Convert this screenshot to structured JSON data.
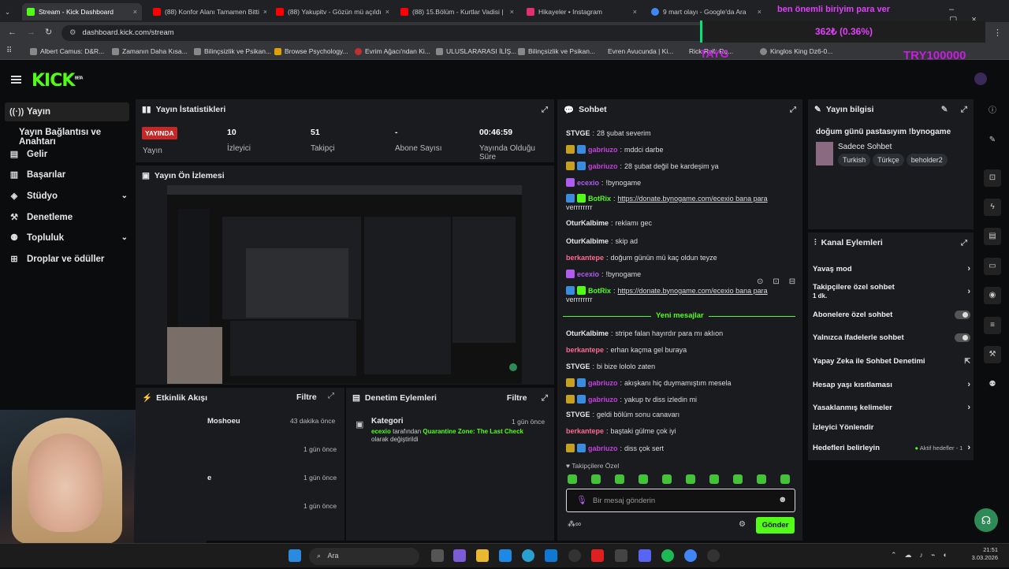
{
  "browser": {
    "tabs": [
      {
        "label": "Stream - Kick Dashboard",
        "color": "#53fc18"
      },
      {
        "label": "(88) Konfor Alanı Tamamen Bitti",
        "color": "#ff0000"
      },
      {
        "label": "(88) Yakupitv - Gözün mü açıldı",
        "color": "#ff0000"
      },
      {
        "label": "(88) 15.Bölüm - Kurtlar Vadisi |",
        "color": "#ff0000"
      },
      {
        "label": "Hikayeler • Instagram",
        "color": "#e1306c"
      },
      {
        "label": "9 mart olayı - Google'da Ara",
        "color": "#4285f4"
      }
    ],
    "url": "dashboard.kick.com/stream",
    "bookmarks": [
      "Albert Camus: D&R...",
      "Zamanın Daha Kısa...",
      "Bilinçsizlik ve Psikan...",
      "Browse Psychology...",
      "Evrim Ağacı'ndan Ki...",
      "ULUSLARARASI İLİŞ...",
      "Bilinçsizlik ve Psikan...",
      "Evren Avucunda | Ki...",
      "Rick Roll: Ro...",
      "Kinglos King Dz6-0..."
    ]
  },
  "overlay": {
    "banner": "ben önemli biriyim para ver",
    "goal": "362₺ (0.36%)",
    "left_tag": "TAYG",
    "right_tag": "TRY100000"
  },
  "kick": {
    "logo": "KICK",
    "beta": "BETA"
  },
  "sidebar": {
    "items": [
      {
        "label": "Yayın",
        "icon": "signal-icon"
      },
      {
        "label": "Yayın Bağlantısı ve Anahtarı",
        "icon": ""
      },
      {
        "label": "Gelir",
        "icon": "wallet-icon"
      },
      {
        "label": "Başarılar",
        "icon": "trophy-icon"
      },
      {
        "label": "Stüdyo",
        "icon": "studio-icon"
      },
      {
        "label": "Denetleme",
        "icon": "hammer-icon"
      },
      {
        "label": "Topluluk",
        "icon": "community-icon"
      },
      {
        "label": "Droplar ve ödüller",
        "icon": "gift-icon"
      }
    ]
  },
  "stats": {
    "title": "Yayın İstatistikleri",
    "live_badge": "YAYINDA",
    "live_label": "Yayın",
    "viewers": {
      "value": "10",
      "label": "İzleyici"
    },
    "followers": {
      "value": "51",
      "label": "Takipçi"
    },
    "subs": {
      "value": "-",
      "label": "Abone Sayısı"
    },
    "uptime": {
      "value": "00:46:59",
      "label": "Yayında Olduğu Süre"
    }
  },
  "preview": {
    "title": "Yayın Ön İzlemesi"
  },
  "activity": {
    "title": "Etkinlik Akışı",
    "filter": "Filtre",
    "items": [
      {
        "name": "Moshoeu",
        "time": "43 dakika önce"
      },
      {
        "name": "",
        "time": "1 gün önce"
      },
      {
        "name": "e",
        "time": "1 gün önce"
      },
      {
        "name": "",
        "time": "1 gün önce"
      }
    ]
  },
  "moderation": {
    "title": "Denetim Eylemleri",
    "filter": "Filtre",
    "item_title": "Kategori",
    "item_time": "1 gün önce",
    "item_user": "ecexio",
    "item_mid": " tarafından ",
    "item_game": "Quarantine Zone: The Last Check",
    "item_end": "olarak değiştirildi"
  },
  "chat": {
    "title": "Sohbet",
    "messages": [
      {
        "user": "STVGE",
        "color": "#e8e8e8",
        "text": "28 şubat severim",
        "badges": []
      },
      {
        "user": "gabriuzo",
        "color": "#c53ee0",
        "text": "mddci darbe",
        "badges": [
          "#c8a020",
          "#3a8dde"
        ]
      },
      {
        "user": "gabriuzo",
        "color": "#c53ee0",
        "text": "28 şubat değil be kardeşim ya",
        "badges": [
          "#c8a020",
          "#3a8dde"
        ]
      },
      {
        "user": "ecexio",
        "color": "#b05cf0",
        "text": "!byno­game",
        "badges": [
          "#b05cf0"
        ]
      },
      {
        "user": "BotRix",
        "color": "#53fc18",
        "text": "https://donate.bynogame.com/ecexio bana para",
        "text2": "verrrrrrrr",
        "badges": [
          "#3a8dde",
          "#53fc18"
        ]
      },
      {
        "user": "OturKalbime",
        "color": "#e8e8e8",
        "text": "reklamı gec",
        "badges": []
      },
      {
        "user": "OturKalbime",
        "color": "#e8e8e8",
        "text": "skip ad",
        "badges": []
      },
      {
        "user": "berkantepe",
        "color": "#ff6a8f",
        "text": "doğum günün mü kaç oldun teyze",
        "badges": []
      },
      {
        "user": "ecexio",
        "color": "#b05cf0",
        "text": "!byno­game",
        "badges": [
          "#b05cf0"
        ]
      },
      {
        "user": "BotRix",
        "color": "#53fc18",
        "text": "https://donate.bynogame.com/ecexio bana para",
        "text2": "verrrrrrrr",
        "badges": [
          "#3a8dde",
          "#53fc18"
        ]
      }
    ],
    "new_messages": "Yeni mesajlar",
    "messages2": [
      {
        "user": "OturKalbime",
        "color": "#e8e8e8",
        "text": "stripe falan hayırdır para mı aklıon",
        "badges": []
      },
      {
        "user": "berkantepe",
        "color": "#ff6a8f",
        "text": "erhan kaçma gel buraya",
        "badges": []
      },
      {
        "user": "STVGE",
        "color": "#e8e8e8",
        "text": "bi bize lololo zaten",
        "badges": []
      },
      {
        "user": "gabriuzo",
        "color": "#c53ee0",
        "text": "akışkanı hiç duymamıştım mesela",
        "badges": [
          "#c8a020",
          "#3a8dde"
        ]
      },
      {
        "user": "gabriuzo",
        "color": "#c53ee0",
        "text": "yakup tv diss izledin mi",
        "badges": [
          "#c8a020",
          "#3a8dde"
        ]
      },
      {
        "user": "STVGE",
        "color": "#e8e8e8",
        "text": "geldi bölüm sonu canavarı",
        "badges": []
      },
      {
        "user": "berkantepe",
        "color": "#ff6a8f",
        "text": "baştaki gülme çok iyi",
        "badges": []
      },
      {
        "user": "gabriuzo",
        "color": "#c53ee0",
        "text": "diss çok sert",
        "badges": [
          "#c8a020",
          "#3a8dde"
        ]
      }
    ],
    "followers_only": "Takipçilere Özel",
    "placeholder": "Bir mesaj gönderin",
    "send": "Gönder"
  },
  "stream_info": {
    "title": "Yayın bilgisi",
    "stream_title": "doğum günü pastasıyım !bynogame",
    "category": "Sadece Sohbet",
    "tags": [
      "Turkish",
      "Türkçe",
      "beholder2"
    ]
  },
  "channel_actions": {
    "title": "Kanal Eylemleri",
    "items": [
      {
        "label": "Yavaş mod",
        "kind": "arrow"
      },
      {
        "label": "Takipçilere özel sohbet",
        "sub": "1 dk.",
        "kind": "arrow"
      },
      {
        "label": "Abonelere özel sohbet",
        "kind": "toggle"
      },
      {
        "label": "Yalnızca ifadelerle sohbet",
        "kind": "toggle"
      },
      {
        "label": "Yapay Zeka ile Sohbet Denetimi",
        "kind": "ext"
      },
      {
        "label": "Hesap yaşı kısıtlaması",
        "kind": "arrow"
      },
      {
        "label": "Yasaklanmış kelimeler",
        "kind": "arrow"
      },
      {
        "label": "İzleyici Yönlendir",
        "kind": "none"
      },
      {
        "label": "Hedefleri belirleyin",
        "kind": "arrow",
        "extra": "Aktif hedefler - 1"
      }
    ]
  },
  "taskbar": {
    "search": "Ara",
    "time": "21:51",
    "date": "3.03.2026"
  }
}
